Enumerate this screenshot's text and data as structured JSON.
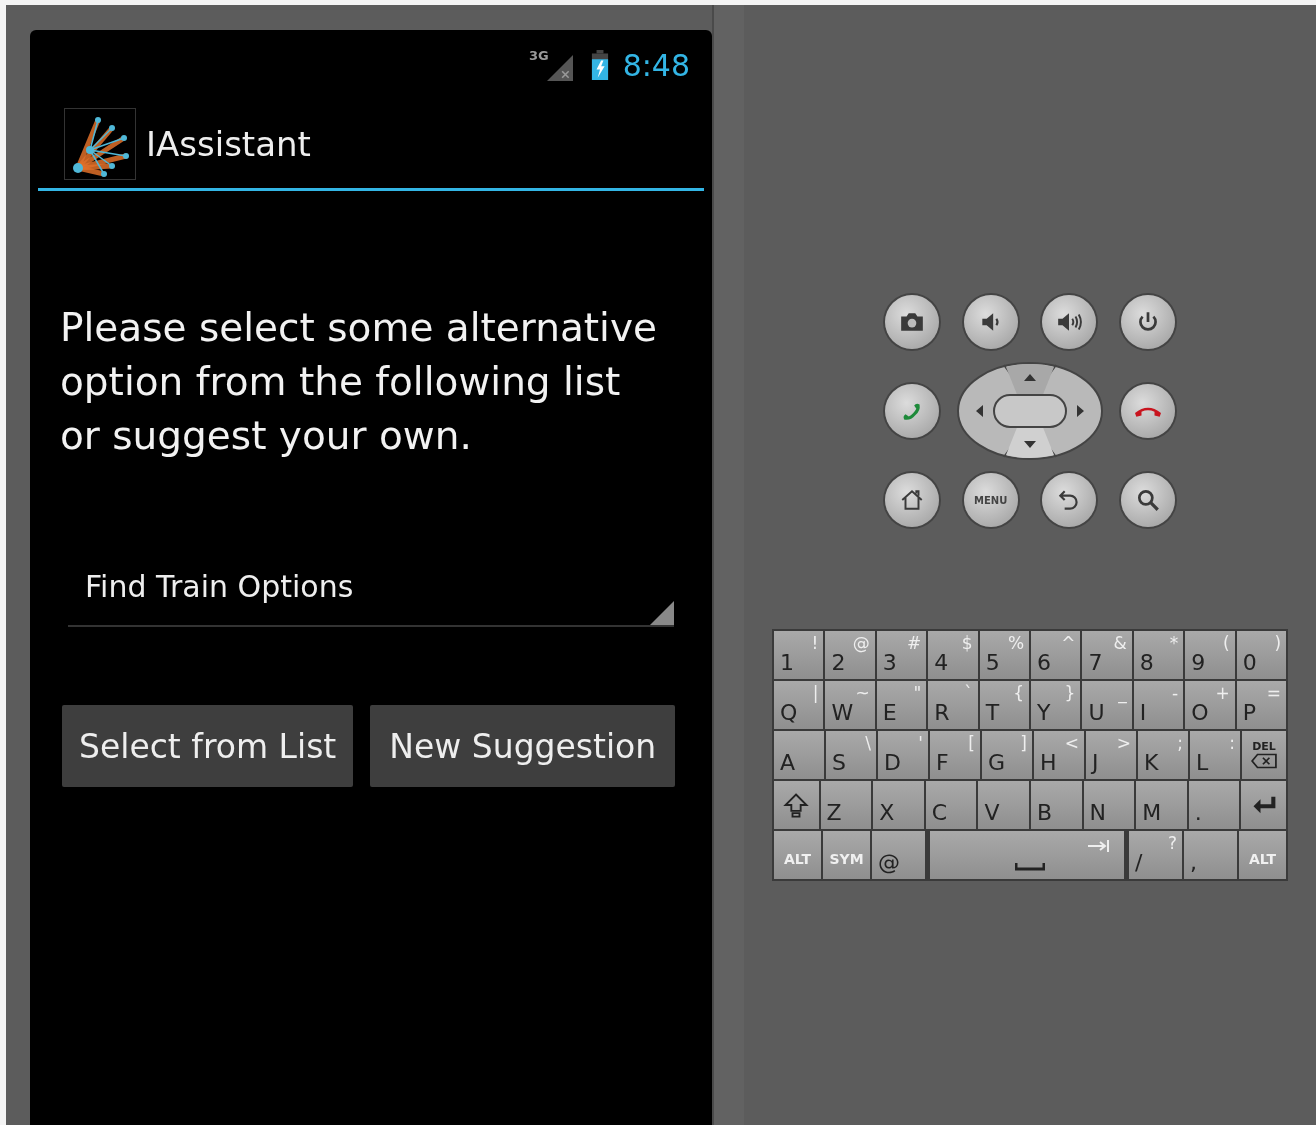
{
  "status_bar": {
    "network": "3G",
    "time": "8:48"
  },
  "action_bar": {
    "title": "IAssistant"
  },
  "message": "Please select some alternative option from the following list or suggest your own.",
  "spinner": {
    "value": "Find Train Options"
  },
  "buttons": [
    "Select from List",
    "New Suggestion"
  ],
  "hardware_keys": {
    "menu_label": "MENU"
  },
  "keyboard": {
    "rows": [
      [
        {
          "kind": "char",
          "label": "1",
          "alt": "!"
        },
        {
          "kind": "char",
          "label": "2",
          "alt": "@"
        },
        {
          "kind": "char",
          "label": "3",
          "alt": "#"
        },
        {
          "kind": "char",
          "label": "4",
          "alt": "$"
        },
        {
          "kind": "char",
          "label": "5",
          "alt": "%"
        },
        {
          "kind": "char",
          "label": "6",
          "alt": "^"
        },
        {
          "kind": "char",
          "label": "7",
          "alt": "&"
        },
        {
          "kind": "char",
          "label": "8",
          "alt": "*"
        },
        {
          "kind": "char",
          "label": "9",
          "alt": "("
        },
        {
          "kind": "char",
          "label": "0",
          "alt": ")"
        }
      ],
      [
        {
          "kind": "char",
          "label": "Q",
          "alt": "|"
        },
        {
          "kind": "char",
          "label": "W",
          "alt": "~"
        },
        {
          "kind": "char",
          "label": "E",
          "alt": "\""
        },
        {
          "kind": "char",
          "label": "R",
          "alt": "`"
        },
        {
          "kind": "char",
          "label": "T",
          "alt": "{"
        },
        {
          "kind": "char",
          "label": "Y",
          "alt": "}"
        },
        {
          "kind": "char",
          "label": "U",
          "alt": "_"
        },
        {
          "kind": "char",
          "label": "I",
          "alt": "-"
        },
        {
          "kind": "char",
          "label": "O",
          "alt": "+"
        },
        {
          "kind": "char",
          "label": "P",
          "alt": "="
        }
      ],
      [
        {
          "kind": "char",
          "label": "A"
        },
        {
          "kind": "char",
          "label": "S",
          "alt": "\\"
        },
        {
          "kind": "char",
          "label": "D",
          "alt": "'"
        },
        {
          "kind": "char",
          "label": "F",
          "alt": "["
        },
        {
          "kind": "char",
          "label": "G",
          "alt": "]"
        },
        {
          "kind": "char",
          "label": "H",
          "alt": "<"
        },
        {
          "kind": "char",
          "label": "J",
          "alt": ">"
        },
        {
          "kind": "char",
          "label": "K",
          "alt": ";"
        },
        {
          "kind": "char",
          "label": "L",
          "alt": ":"
        },
        {
          "kind": "del",
          "label": "DEL"
        }
      ],
      [
        {
          "kind": "shift"
        },
        {
          "kind": "char",
          "label": "Z"
        },
        {
          "kind": "char",
          "label": "X"
        },
        {
          "kind": "char",
          "label": "C"
        },
        {
          "kind": "char",
          "label": "V"
        },
        {
          "kind": "char",
          "label": "B"
        },
        {
          "kind": "char",
          "label": "N"
        },
        {
          "kind": "char",
          "label": "M"
        },
        {
          "kind": "char",
          "label": "."
        },
        {
          "kind": "enter"
        }
      ]
    ],
    "bottom_row": [
      {
        "kind": "mod",
        "label": "ALT"
      },
      {
        "kind": "mod",
        "label": "SYM"
      },
      {
        "kind": "char",
        "label": "@"
      },
      {
        "kind": "space"
      },
      {
        "kind": "char",
        "label": "/",
        "alt": "?"
      },
      {
        "kind": "char",
        "label": ","
      },
      {
        "kind": "mod",
        "label": "ALT"
      }
    ]
  }
}
